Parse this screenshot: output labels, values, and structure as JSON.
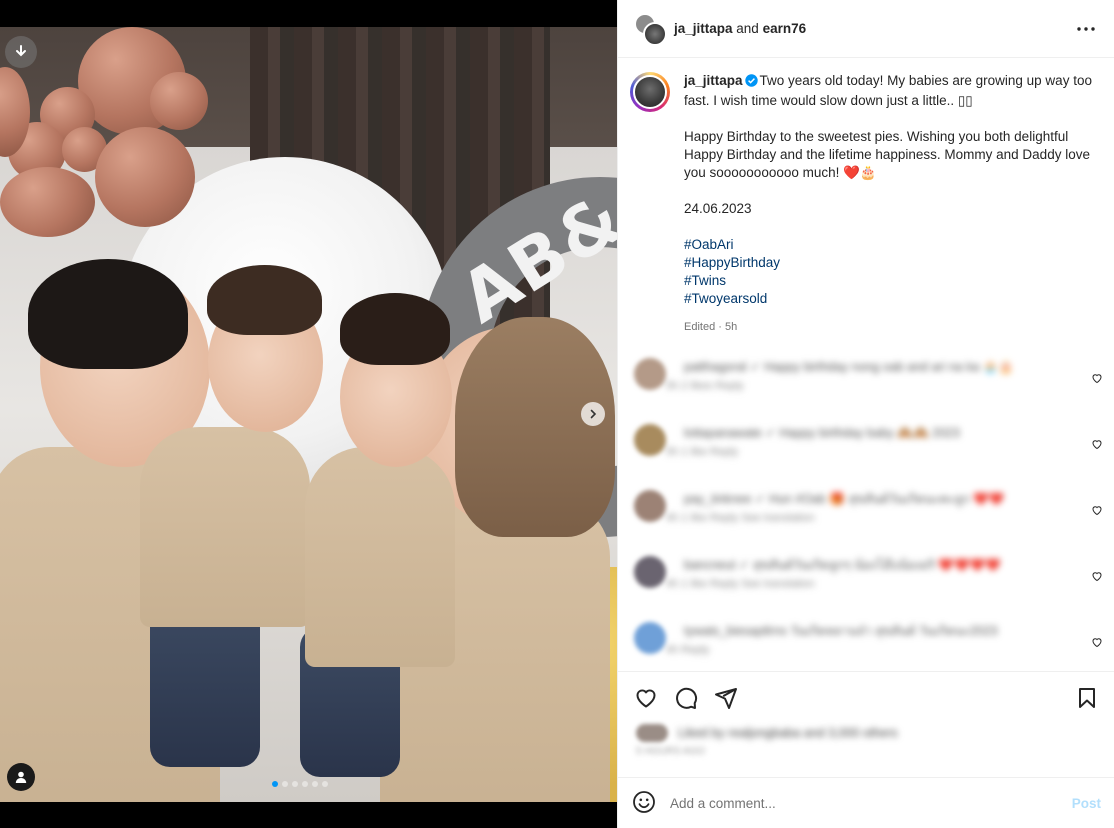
{
  "header": {
    "username": "ja_jittapa",
    "connector": " and ",
    "collaborator": "earn76",
    "more_icon": "more-horizontal-icon"
  },
  "caption": {
    "username": "ja_jittapa",
    "verified": true,
    "line1": "Two years old today! My babies are growing up way too fast. I wish time would slow down just a little.. ▯▯",
    "line2": "Happy Birthday to the sweetest pies. Wishing you both delightful Happy Birthday and the lifetime happiness. Mommy and Daddy love you sooooooooooo much! ❤️🎂",
    "date": "24.06.2023",
    "hashtags": [
      "#OabAri",
      "#HappyBirthday",
      "#Twins",
      "#Twoyearsold"
    ],
    "edited": "Edited · 5h"
  },
  "comments": [
    {
      "text": "patthagoral ✓ Happy birthday nong oab and ari na ka 🧁🎂",
      "meta": "5h   2 likes   Reply",
      "avatar_color": "#b49a88"
    },
    {
      "text": "lottapanawate ✓ Happy birthday baby 🙈🙈 2023",
      "meta": "5h   1 like   Reply",
      "avatar_color": "#a88b5e"
    },
    {
      "text": "pay_tinknee ✓ Hun #Oab 🎁 สุขสันต์วันเกิดนะคะลูก ❤️❤️",
      "meta": "4h   1 like   Reply   See translation",
      "avatar_color": "#9c8275"
    },
    {
      "text": "bancneut ✓ สุขสันต์วันเกิดลูกๆ น้องโอ๊บน้องอริ ❤️❤️❤️❤️",
      "meta": "4h   1 like   Reply   See translation",
      "avatar_color": "#6a6470"
    },
    {
      "text": "tywats_biesaptlrns วันเกิดหลานจ๋า สุขสันต์ วันเกิดนะ2023",
      "meta": "4h   Reply",
      "avatar_color": "#6fa0d8"
    }
  ],
  "likes": {
    "text": "Liked by realjongbaba and 3,000 others",
    "date": "5 HOURS AGO"
  },
  "composer": {
    "placeholder": "Add a comment...",
    "post_label": "Post",
    "emoji_icon": "emoji-icon"
  },
  "media": {
    "carousel_count": 6,
    "active_index": 0,
    "photo_letters": "AB&"
  },
  "colors": {
    "link": "#00376b",
    "accent": "#0095f6",
    "post_disabled": "#b2dffc"
  }
}
